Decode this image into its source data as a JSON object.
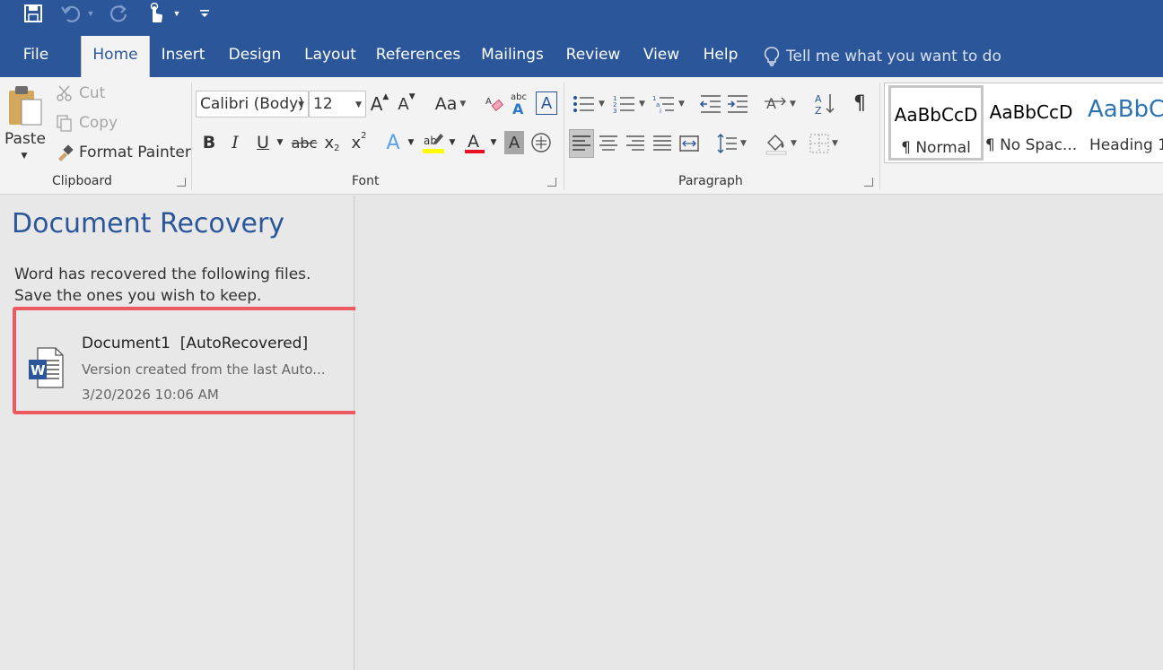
{
  "tabs": [
    "File",
    "Home",
    "Insert",
    "Design",
    "Layout",
    "References",
    "Mailings",
    "Review",
    "View",
    "Help"
  ],
  "tell_me": "Tell me what you want to do",
  "clipboard": {
    "paste": "Paste",
    "cut": "Cut",
    "copy": "Copy",
    "format_painter": "Format Painter",
    "label": "Clipboard"
  },
  "font": {
    "name": "Calibri (Body)",
    "size": "12",
    "label": "Font",
    "grow": "A",
    "shrink": "A",
    "case": "Aa",
    "bold": "B",
    "italic": "I",
    "underline": "U",
    "strike": "abc",
    "subscript": "x",
    "superscript": "x",
    "clear": "abc",
    "text_effect": "A",
    "font_color": "A",
    "shading": "A",
    "char_border": "A"
  },
  "paragraph": {
    "label": "Paragraph",
    "pilcrow": "¶"
  },
  "styles": [
    {
      "sample": "AaBbCcD",
      "name": "¶ Normal"
    },
    {
      "sample": "AaBbCcD",
      "name": "¶ No Spac..."
    },
    {
      "sample": "AaBbC",
      "name": "Heading 1"
    }
  ],
  "recovery": {
    "title": "Document Recovery",
    "description": "Word has recovered the following files.  Save the ones you wish to keep.",
    "file": {
      "name": "Document1  [AutoRecovered]",
      "description": "Version created from the last Auto...",
      "date": "3/20/2026 10:06 AM"
    }
  },
  "colors": {
    "brand": "#2b579a",
    "highlight": "#ffff00",
    "font_color": "#e81123",
    "selection_outline": "#eb5a5f"
  }
}
